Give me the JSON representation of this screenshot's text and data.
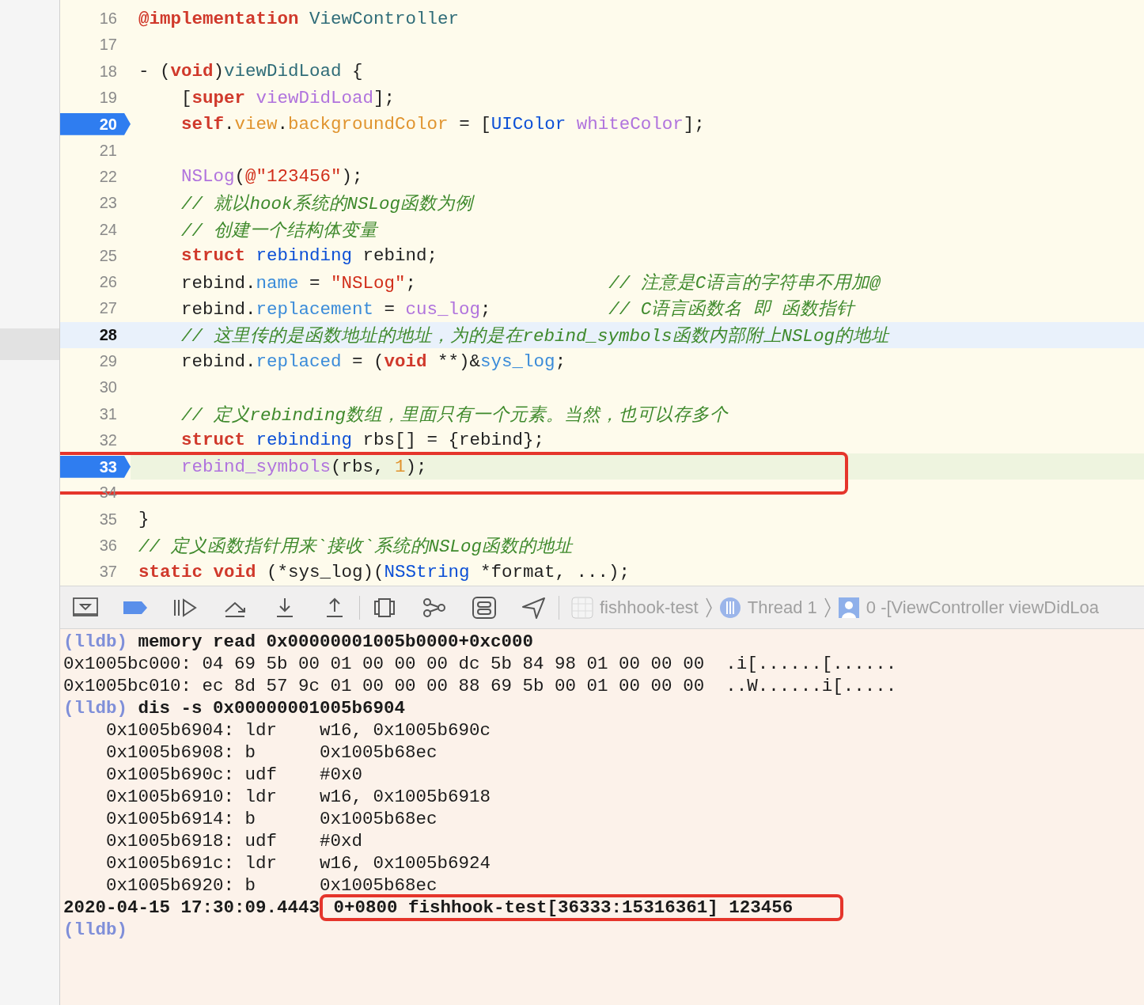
{
  "editor": {
    "lines": [
      {
        "number": "16",
        "breakpoint": false,
        "cursor": false,
        "executing": false,
        "boxed": false,
        "tokens": [
          {
            "kind": "kw",
            "text": "@implementation"
          },
          {
            "kind": "cls",
            "text": " ViewController"
          }
        ]
      },
      {
        "number": "17",
        "breakpoint": false,
        "cursor": false,
        "executing": false,
        "boxed": false
      },
      {
        "number": "18",
        "breakpoint": false,
        "cursor": false,
        "executing": false,
        "boxed": false,
        "tokens": [
          {
            "kind": "plain",
            "text": "- ("
          },
          {
            "kind": "kw",
            "text": "void"
          },
          {
            "kind": "plain",
            "text": ")"
          },
          {
            "kind": "cls",
            "text": "viewDidLoad"
          },
          {
            "kind": "plain",
            "text": " {"
          }
        ]
      },
      {
        "number": "19",
        "breakpoint": false,
        "cursor": false,
        "executing": false,
        "boxed": false,
        "tokens": [
          {
            "kind": "plain",
            "text": "    ["
          },
          {
            "kind": "kw",
            "text": "super"
          },
          {
            "kind": "fn",
            "text": " viewDidLoad"
          },
          {
            "kind": "plain",
            "text": "];"
          }
        ]
      },
      {
        "number": "20",
        "breakpoint": true,
        "cursor": false,
        "executing": false,
        "boxed": false,
        "tokens": [
          {
            "kind": "kw",
            "text": "    self"
          },
          {
            "kind": "plain",
            "text": "."
          },
          {
            "kind": "prop",
            "text": "view"
          },
          {
            "kind": "plain",
            "text": "."
          },
          {
            "kind": "prop",
            "text": "backgroundColor"
          },
          {
            "kind": "plain",
            "text": " = ["
          },
          {
            "kind": "type",
            "text": "UIColor"
          },
          {
            "kind": "fn",
            "text": " whiteColor"
          },
          {
            "kind": "plain",
            "text": "];"
          }
        ]
      },
      {
        "number": "21",
        "breakpoint": false,
        "cursor": false,
        "executing": false,
        "boxed": false
      },
      {
        "number": "22",
        "breakpoint": false,
        "cursor": false,
        "executing": false,
        "boxed": false,
        "tokens": [
          {
            "kind": "fn",
            "text": "    NSLog"
          },
          {
            "kind": "plain",
            "text": "("
          },
          {
            "kind": "str",
            "text": "@\"123456\""
          },
          {
            "kind": "plain",
            "text": ");"
          }
        ]
      },
      {
        "number": "23",
        "breakpoint": false,
        "cursor": false,
        "executing": false,
        "boxed": false,
        "tokens": [
          {
            "kind": "cmt",
            "text": "    // 就以hook系统的NSLog函数为例"
          }
        ]
      },
      {
        "number": "24",
        "breakpoint": false,
        "cursor": false,
        "executing": false,
        "boxed": false,
        "tokens": [
          {
            "kind": "cmt",
            "text": "    // 创建一个结构体变量"
          }
        ]
      },
      {
        "number": "25",
        "breakpoint": false,
        "cursor": false,
        "executing": false,
        "boxed": false,
        "tokens": [
          {
            "kind": "kw",
            "text": "    struct"
          },
          {
            "kind": "type",
            "text": " rebinding"
          },
          {
            "kind": "plain",
            "text": " rebind;"
          }
        ]
      },
      {
        "number": "26",
        "breakpoint": false,
        "cursor": false,
        "executing": false,
        "boxed": false,
        "tokens": [
          {
            "kind": "plain",
            "text": "    rebind."
          },
          {
            "kind": "member",
            "text": "name"
          },
          {
            "kind": "plain",
            "text": " = "
          },
          {
            "kind": "str",
            "text": "\"NSLog\""
          },
          {
            "kind": "plain",
            "text": ";"
          },
          {
            "kind": "cmt",
            "text": "                  // 注意是C语言的字符串不用加@"
          }
        ]
      },
      {
        "number": "27",
        "breakpoint": false,
        "cursor": false,
        "executing": false,
        "boxed": false,
        "tokens": [
          {
            "kind": "plain",
            "text": "    rebind."
          },
          {
            "kind": "member",
            "text": "replacement"
          },
          {
            "kind": "plain",
            "text": " = "
          },
          {
            "kind": "fn",
            "text": "cus_log"
          },
          {
            "kind": "plain",
            "text": ";"
          },
          {
            "kind": "cmt",
            "text": "           // C语言函数名 即 函数指针"
          }
        ]
      },
      {
        "number": "28",
        "breakpoint": false,
        "cursor": true,
        "executing": false,
        "boxed": false,
        "tokens": [
          {
            "kind": "cmt",
            "text": "    // 这里传的是函数地址的地址，为的是在rebind_symbols函数内部附上NSLog的地址"
          }
        ]
      },
      {
        "number": "29",
        "breakpoint": false,
        "cursor": false,
        "executing": false,
        "boxed": false,
        "tokens": [
          {
            "kind": "plain",
            "text": "    rebind."
          },
          {
            "kind": "member",
            "text": "replaced"
          },
          {
            "kind": "plain",
            "text": " = ("
          },
          {
            "kind": "kw",
            "text": "void"
          },
          {
            "kind": "plain",
            "text": " **)&"
          },
          {
            "kind": "member",
            "text": "sys_log"
          },
          {
            "kind": "plain",
            "text": ";"
          }
        ]
      },
      {
        "number": "30",
        "breakpoint": false,
        "cursor": false,
        "executing": false,
        "boxed": false
      },
      {
        "number": "31",
        "breakpoint": false,
        "cursor": false,
        "executing": false,
        "boxed": false,
        "tokens": [
          {
            "kind": "cmt",
            "text": "    // 定义rebinding数组，里面只有一个元素。当然，也可以存多个"
          }
        ]
      },
      {
        "number": "32",
        "breakpoint": false,
        "cursor": false,
        "executing": false,
        "boxed": false,
        "tokens": [
          {
            "kind": "kw",
            "text": "    struct"
          },
          {
            "kind": "type",
            "text": " rebinding"
          },
          {
            "kind": "plain",
            "text": " rbs[] = {rebind};"
          }
        ]
      },
      {
        "number": "33",
        "breakpoint": true,
        "cursor": false,
        "executing": true,
        "boxed": true,
        "tokens": [
          {
            "kind": "fn",
            "text": "    rebind_symbols"
          },
          {
            "kind": "plain",
            "text": "(rbs, "
          },
          {
            "kind": "num",
            "text": "1"
          },
          {
            "kind": "plain",
            "text": ");"
          }
        ]
      },
      {
        "number": "34",
        "breakpoint": false,
        "cursor": false,
        "executing": false,
        "boxed": false
      },
      {
        "number": "35",
        "breakpoint": false,
        "cursor": false,
        "executing": false,
        "boxed": false,
        "tokens": [
          {
            "kind": "plain",
            "text": "}"
          }
        ]
      },
      {
        "number": "36",
        "breakpoint": false,
        "cursor": false,
        "executing": false,
        "boxed": false,
        "tokens": [
          {
            "kind": "cmt",
            "text": "// 定义函数指针用来`接收`系统的NSLog函数的地址"
          }
        ]
      },
      {
        "number": "37",
        "breakpoint": false,
        "cursor": false,
        "executing": false,
        "boxed": false,
        "tokens": [
          {
            "kind": "kw",
            "text": "static"
          },
          {
            "kind": "kw",
            "text": " void"
          },
          {
            "kind": "plain",
            "text": " (*sys_log)("
          },
          {
            "kind": "type",
            "text": "NSString"
          },
          {
            "kind": "plain",
            "text": " *format, ...);"
          }
        ]
      }
    ]
  },
  "debug_bar": {
    "breadcrumbs": [
      "fishhook-test",
      "Thread 1",
      "0 -[ViewController viewDidLoa"
    ]
  },
  "console": {
    "lines": [
      {
        "kind": "command",
        "prompt": "(lldb)",
        "text": "memory read 0x00000001005b0000+0xc000"
      },
      {
        "kind": "output",
        "text": "0x1005bc000: 04 69 5b 00 01 00 00 00 dc 5b 84 98 01 00 00 00  .i[......[......"
      },
      {
        "kind": "output",
        "text": "0x1005bc010: ec 8d 57 9c 01 00 00 00 88 69 5b 00 01 00 00 00  ..W......i[....."
      },
      {
        "kind": "command",
        "prompt": "(lldb)",
        "text": "dis -s 0x00000001005b6904"
      },
      {
        "kind": "output",
        "text": "    0x1005b6904: ldr    w16, 0x1005b690c"
      },
      {
        "kind": "output",
        "text": "    0x1005b6908: b      0x1005b68ec"
      },
      {
        "kind": "output",
        "text": "    0x1005b690c: udf    #0x0"
      },
      {
        "kind": "output",
        "text": "    0x1005b6910: ldr    w16, 0x1005b6918"
      },
      {
        "kind": "output",
        "text": "    0x1005b6914: b      0x1005b68ec"
      },
      {
        "kind": "output",
        "text": "    0x1005b6918: udf    #0xd"
      },
      {
        "kind": "output",
        "text": "    0x1005b691c: ldr    w16, 0x1005b6924"
      },
      {
        "kind": "output",
        "text": "    0x1005b6920: b      0x1005b68ec"
      },
      {
        "kind": "log",
        "boxed": true,
        "text": "2020-04-15 17:30:09.4443",
        "boxed_text": "0+0800 fishhook-test[36333:15316361] 123456"
      },
      {
        "kind": "prompt",
        "prompt": "(lldb)"
      }
    ]
  }
}
